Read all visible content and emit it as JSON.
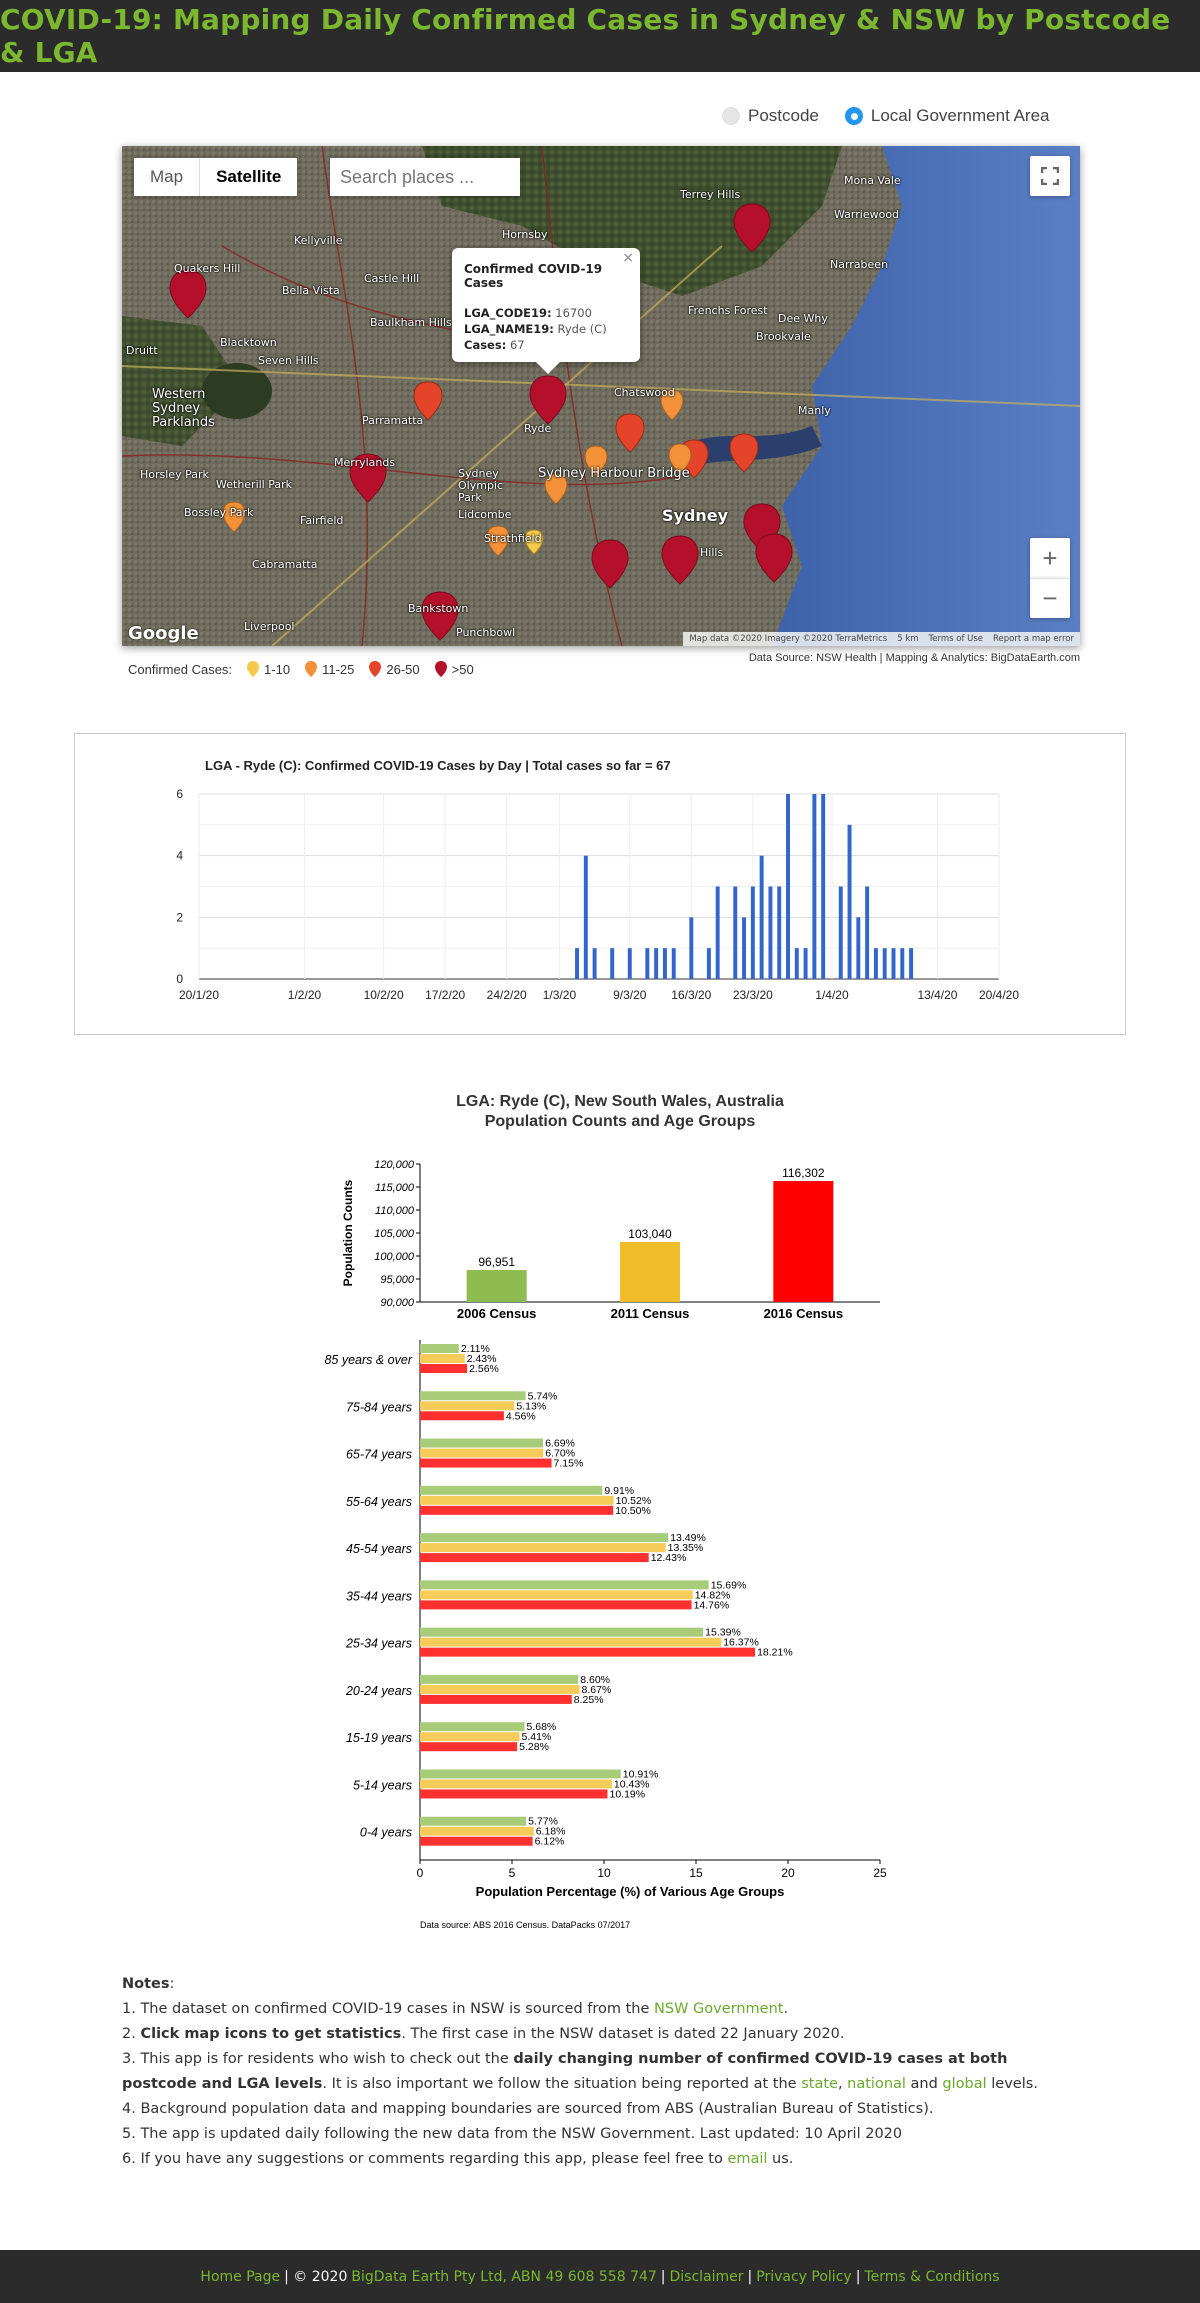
{
  "header": {
    "title": "COVID-19: Mapping Daily Confirmed Cases in Sydney & NSW by Postcode & LGA"
  },
  "mode_toggle": {
    "options": [
      {
        "label": "Postcode",
        "checked": false
      },
      {
        "label": "Local Government Area",
        "checked": true
      }
    ]
  },
  "map": {
    "type_buttons": [
      "Map",
      "Satellite"
    ],
    "active_type": "Satellite",
    "search_placeholder": "Search places ...",
    "fullscreen_icon": "fullscreen-icon",
    "zoom_in_label": "+",
    "zoom_out_label": "−",
    "google_label": "Google",
    "attribution": [
      "Map data ©2020 Imagery ©2020 TerraMetrics",
      "5 km",
      "Terms of Use",
      "Report a map error"
    ],
    "info_window": {
      "title": "Confirmed COVID-19 Cases",
      "lines": [
        {
          "key": "LGA_CODE19:",
          "value": "16700"
        },
        {
          "key": "LGA_NAME19:",
          "value": "Ryde (C)"
        },
        {
          "key": "Cases:",
          "value": "67"
        }
      ]
    },
    "place_labels": [
      {
        "text": "Terrey Hills",
        "class": ""
      },
      {
        "text": "Mona Vale",
        "class": ""
      },
      {
        "text": "Warriewood",
        "class": ""
      },
      {
        "text": "Hornsby",
        "class": ""
      },
      {
        "text": "Kellyville",
        "class": ""
      },
      {
        "text": "Quakers Hill",
        "class": ""
      },
      {
        "text": "Bella Vista",
        "class": ""
      },
      {
        "text": "Castle Hill",
        "class": ""
      },
      {
        "text": "Narrabeen",
        "class": ""
      },
      {
        "text": "Frenchs Forest",
        "class": ""
      },
      {
        "text": "Dee Why",
        "class": ""
      },
      {
        "text": "Brookvale",
        "class": ""
      },
      {
        "text": "Blacktown",
        "class": ""
      },
      {
        "text": "Baulkham Hills",
        "class": ""
      },
      {
        "text": "Seven Hills",
        "class": ""
      },
      {
        "text": "Druitt",
        "class": ""
      },
      {
        "text": "Western Sydney Parklands",
        "class": "mid"
      },
      {
        "text": "Chatswood",
        "class": ""
      },
      {
        "text": "Manly",
        "class": ""
      },
      {
        "text": "Parramatta",
        "class": ""
      },
      {
        "text": "Ryde",
        "class": ""
      },
      {
        "text": "Horsley Park",
        "class": ""
      },
      {
        "text": "Wetherill Park",
        "class": ""
      },
      {
        "text": "Merrylands",
        "class": ""
      },
      {
        "text": "Sydney Olympic Park",
        "class": ""
      },
      {
        "text": "Sydney Harbour Bridge",
        "class": "mid"
      },
      {
        "text": "Bossley Park",
        "class": ""
      },
      {
        "text": "Fairfield",
        "class": ""
      },
      {
        "text": "Lidcombe",
        "class": ""
      },
      {
        "text": "Sydney",
        "class": "big"
      },
      {
        "text": "Cabramatta",
        "class": ""
      },
      {
        "text": "Strathfield",
        "class": ""
      },
      {
        "text": "Hills",
        "class": ""
      },
      {
        "text": "Liverpool",
        "class": ""
      },
      {
        "text": "Bankstown",
        "class": ""
      },
      {
        "text": "Punchbowl",
        "class": ""
      }
    ]
  },
  "map_legend": {
    "label": "Confirmed Cases:",
    "items": [
      {
        "label": "1-10",
        "color": "#f5c94a"
      },
      {
        "label": "11-25",
        "color": "#f2913a"
      },
      {
        "label": "26-50",
        "color": "#e4452a"
      },
      {
        "label": ">50",
        "color": "#b5102b"
      }
    ],
    "source": "Data Source: NSW Health | Mapping & Analytics: BigDataEarth.com"
  },
  "chart_data": [
    {
      "type": "bar",
      "title": "LGA - Ryde (C): Confirmed COVID-19 Cases by Day | Total cases so far = 67",
      "x_start": "2020-01-20",
      "x_end": "2020-04-20",
      "x_ticks": [
        "20/1/20",
        "1/2/20",
        "10/2/20",
        "17/2/20",
        "24/2/20",
        "1/3/20",
        "9/3/20",
        "16/3/20",
        "23/3/20",
        "1/4/20",
        "13/4/20",
        "20/4/20"
      ],
      "y_ticks": [
        0,
        2,
        4,
        6
      ],
      "ylim": [
        0,
        6
      ],
      "color": "#3366cc",
      "points": [
        {
          "x": "2020-03-03",
          "y": 1
        },
        {
          "x": "2020-03-04",
          "y": 4
        },
        {
          "x": "2020-03-05",
          "y": 1
        },
        {
          "x": "2020-03-07",
          "y": 1
        },
        {
          "x": "2020-03-09",
          "y": 1
        },
        {
          "x": "2020-03-11",
          "y": 1
        },
        {
          "x": "2020-03-12",
          "y": 1
        },
        {
          "x": "2020-03-13",
          "y": 1
        },
        {
          "x": "2020-03-14",
          "y": 1
        },
        {
          "x": "2020-03-16",
          "y": 2
        },
        {
          "x": "2020-03-18",
          "y": 1
        },
        {
          "x": "2020-03-19",
          "y": 3
        },
        {
          "x": "2020-03-21",
          "y": 3
        },
        {
          "x": "2020-03-22",
          "y": 2
        },
        {
          "x": "2020-03-23",
          "y": 3
        },
        {
          "x": "2020-03-24",
          "y": 4
        },
        {
          "x": "2020-03-25",
          "y": 3
        },
        {
          "x": "2020-03-26",
          "y": 3
        },
        {
          "x": "2020-03-27",
          "y": 6
        },
        {
          "x": "2020-03-28",
          "y": 1
        },
        {
          "x": "2020-03-29",
          "y": 1
        },
        {
          "x": "2020-03-30",
          "y": 6
        },
        {
          "x": "2020-03-31",
          "y": 6
        },
        {
          "x": "2020-04-02",
          "y": 3
        },
        {
          "x": "2020-04-03",
          "y": 5
        },
        {
          "x": "2020-04-04",
          "y": 2
        },
        {
          "x": "2020-04-05",
          "y": 3
        },
        {
          "x": "2020-04-06",
          "y": 1
        },
        {
          "x": "2020-04-07",
          "y": 1
        },
        {
          "x": "2020-04-08",
          "y": 1
        },
        {
          "x": "2020-04-09",
          "y": 1
        },
        {
          "x": "2020-04-10",
          "y": 1
        }
      ]
    },
    {
      "type": "bar",
      "title": "LGA: Ryde (C), New South Wales, Australia",
      "subtitle": "Population Counts and Age Groups",
      "ylabel": "Population Counts",
      "categories": [
        "2006 Census",
        "2011 Census",
        "2016 Census"
      ],
      "values": [
        96951,
        103040,
        116302
      ],
      "value_labels": [
        "96,951",
        "103,040",
        "116,302"
      ],
      "colors": [
        "#8ebc50",
        "#f0bc2a",
        "#ff0000"
      ],
      "ylim": [
        90000,
        120000
      ],
      "y_ticks": [
        "90,000",
        "95,000",
        "100,000",
        "105,000",
        "110,000",
        "115,000",
        "120,000"
      ]
    },
    {
      "type": "bar",
      "orientation": "horizontal",
      "xlabel": "Population Percentage (%) of Various Age Groups",
      "xlim": [
        0,
        25
      ],
      "x_ticks": [
        0,
        5,
        10,
        15,
        20,
        25
      ],
      "categories": [
        "85 years & over",
        "75-84 years",
        "65-74 years",
        "55-64 years",
        "45-54 years",
        "35-44 years",
        "25-34 years",
        "20-24 years",
        "15-19 years",
        "5-14 years",
        "0-4 years"
      ],
      "series_colors": [
        "#a9cc7a",
        "#f5cc5a",
        "#ff3030"
      ],
      "series": [
        {
          "values": [
            2.11,
            5.74,
            6.69,
            9.91,
            13.49,
            15.69,
            15.39,
            8.6,
            5.68,
            10.91,
            5.77
          ],
          "labels": [
            "2.11%",
            "5.74%",
            "6.69%",
            "9.91%",
            "13.49%",
            "15.69%",
            "15.39%",
            "8.60%",
            "5.68%",
            "10.91%",
            "5.77%"
          ]
        },
        {
          "values": [
            2.43,
            5.13,
            6.7,
            10.52,
            13.35,
            14.82,
            16.37,
            8.67,
            5.41,
            10.43,
            6.18
          ],
          "labels": [
            "2.43%",
            "5.13%",
            "6.70%",
            "10.52%",
            "13.35%",
            "14.82%",
            "16.37%",
            "8.67%",
            "5.41%",
            "10.43%",
            "6.18%"
          ]
        },
        {
          "values": [
            2.56,
            4.56,
            7.15,
            10.5,
            12.43,
            14.76,
            18.21,
            8.25,
            5.28,
            10.19,
            6.12
          ],
          "labels": [
            "2.56%",
            "4.56%",
            "7.15%",
            "10.50%",
            "12.43%",
            "14.76%",
            "18.21%",
            "8.25%",
            "5.28%",
            "10.19%",
            "6.12%"
          ]
        }
      ],
      "source": "Data source: ABS 2016 Census, DataPacks 07/2017"
    }
  ],
  "notes": {
    "title": "Notes",
    "n1_pre": "1. The dataset on confirmed COVID-19 cases in NSW is sourced from the ",
    "n1_link": "NSW Government",
    "n1_post": ".",
    "n2_pre": "2. ",
    "n2_bold": "Click map icons to get statistics",
    "n2_post": ". The first case in the NSW dataset is dated 22 January 2020.",
    "n3_pre": "3. This app is for residents who wish to check out the ",
    "n3_bold": "daily changing number of confirmed COVID-19 cases at both postcode and LGA levels",
    "n3_mid": ". It is also important we follow the situation being reported at the ",
    "n3_link1": "state",
    "n3_sep1": ", ",
    "n3_link2": "national",
    "n3_sep2": " and ",
    "n3_link3": "global",
    "n3_post": " levels.",
    "n4": "4. Background population data and mapping boundaries are sourced from ABS (Australian Bureau of Statistics).",
    "n5": "5. The app is updated daily following the new data from the NSW Government. Last updated: 10 April 2020",
    "n6_pre": "6. If you have any suggestions or comments regarding this app, please feel free to ",
    "n6_link": "email",
    "n6_post": " us."
  },
  "footer": {
    "home": "Home Page",
    "copyright": " | © 2020 ",
    "company": "BigData Earth Pty Ltd, ABN 49 608 558 747",
    "sep": " | ",
    "disclaimer": "Disclaimer",
    "privacy": "Privacy Policy",
    "terms": "Terms & Conditions"
  }
}
